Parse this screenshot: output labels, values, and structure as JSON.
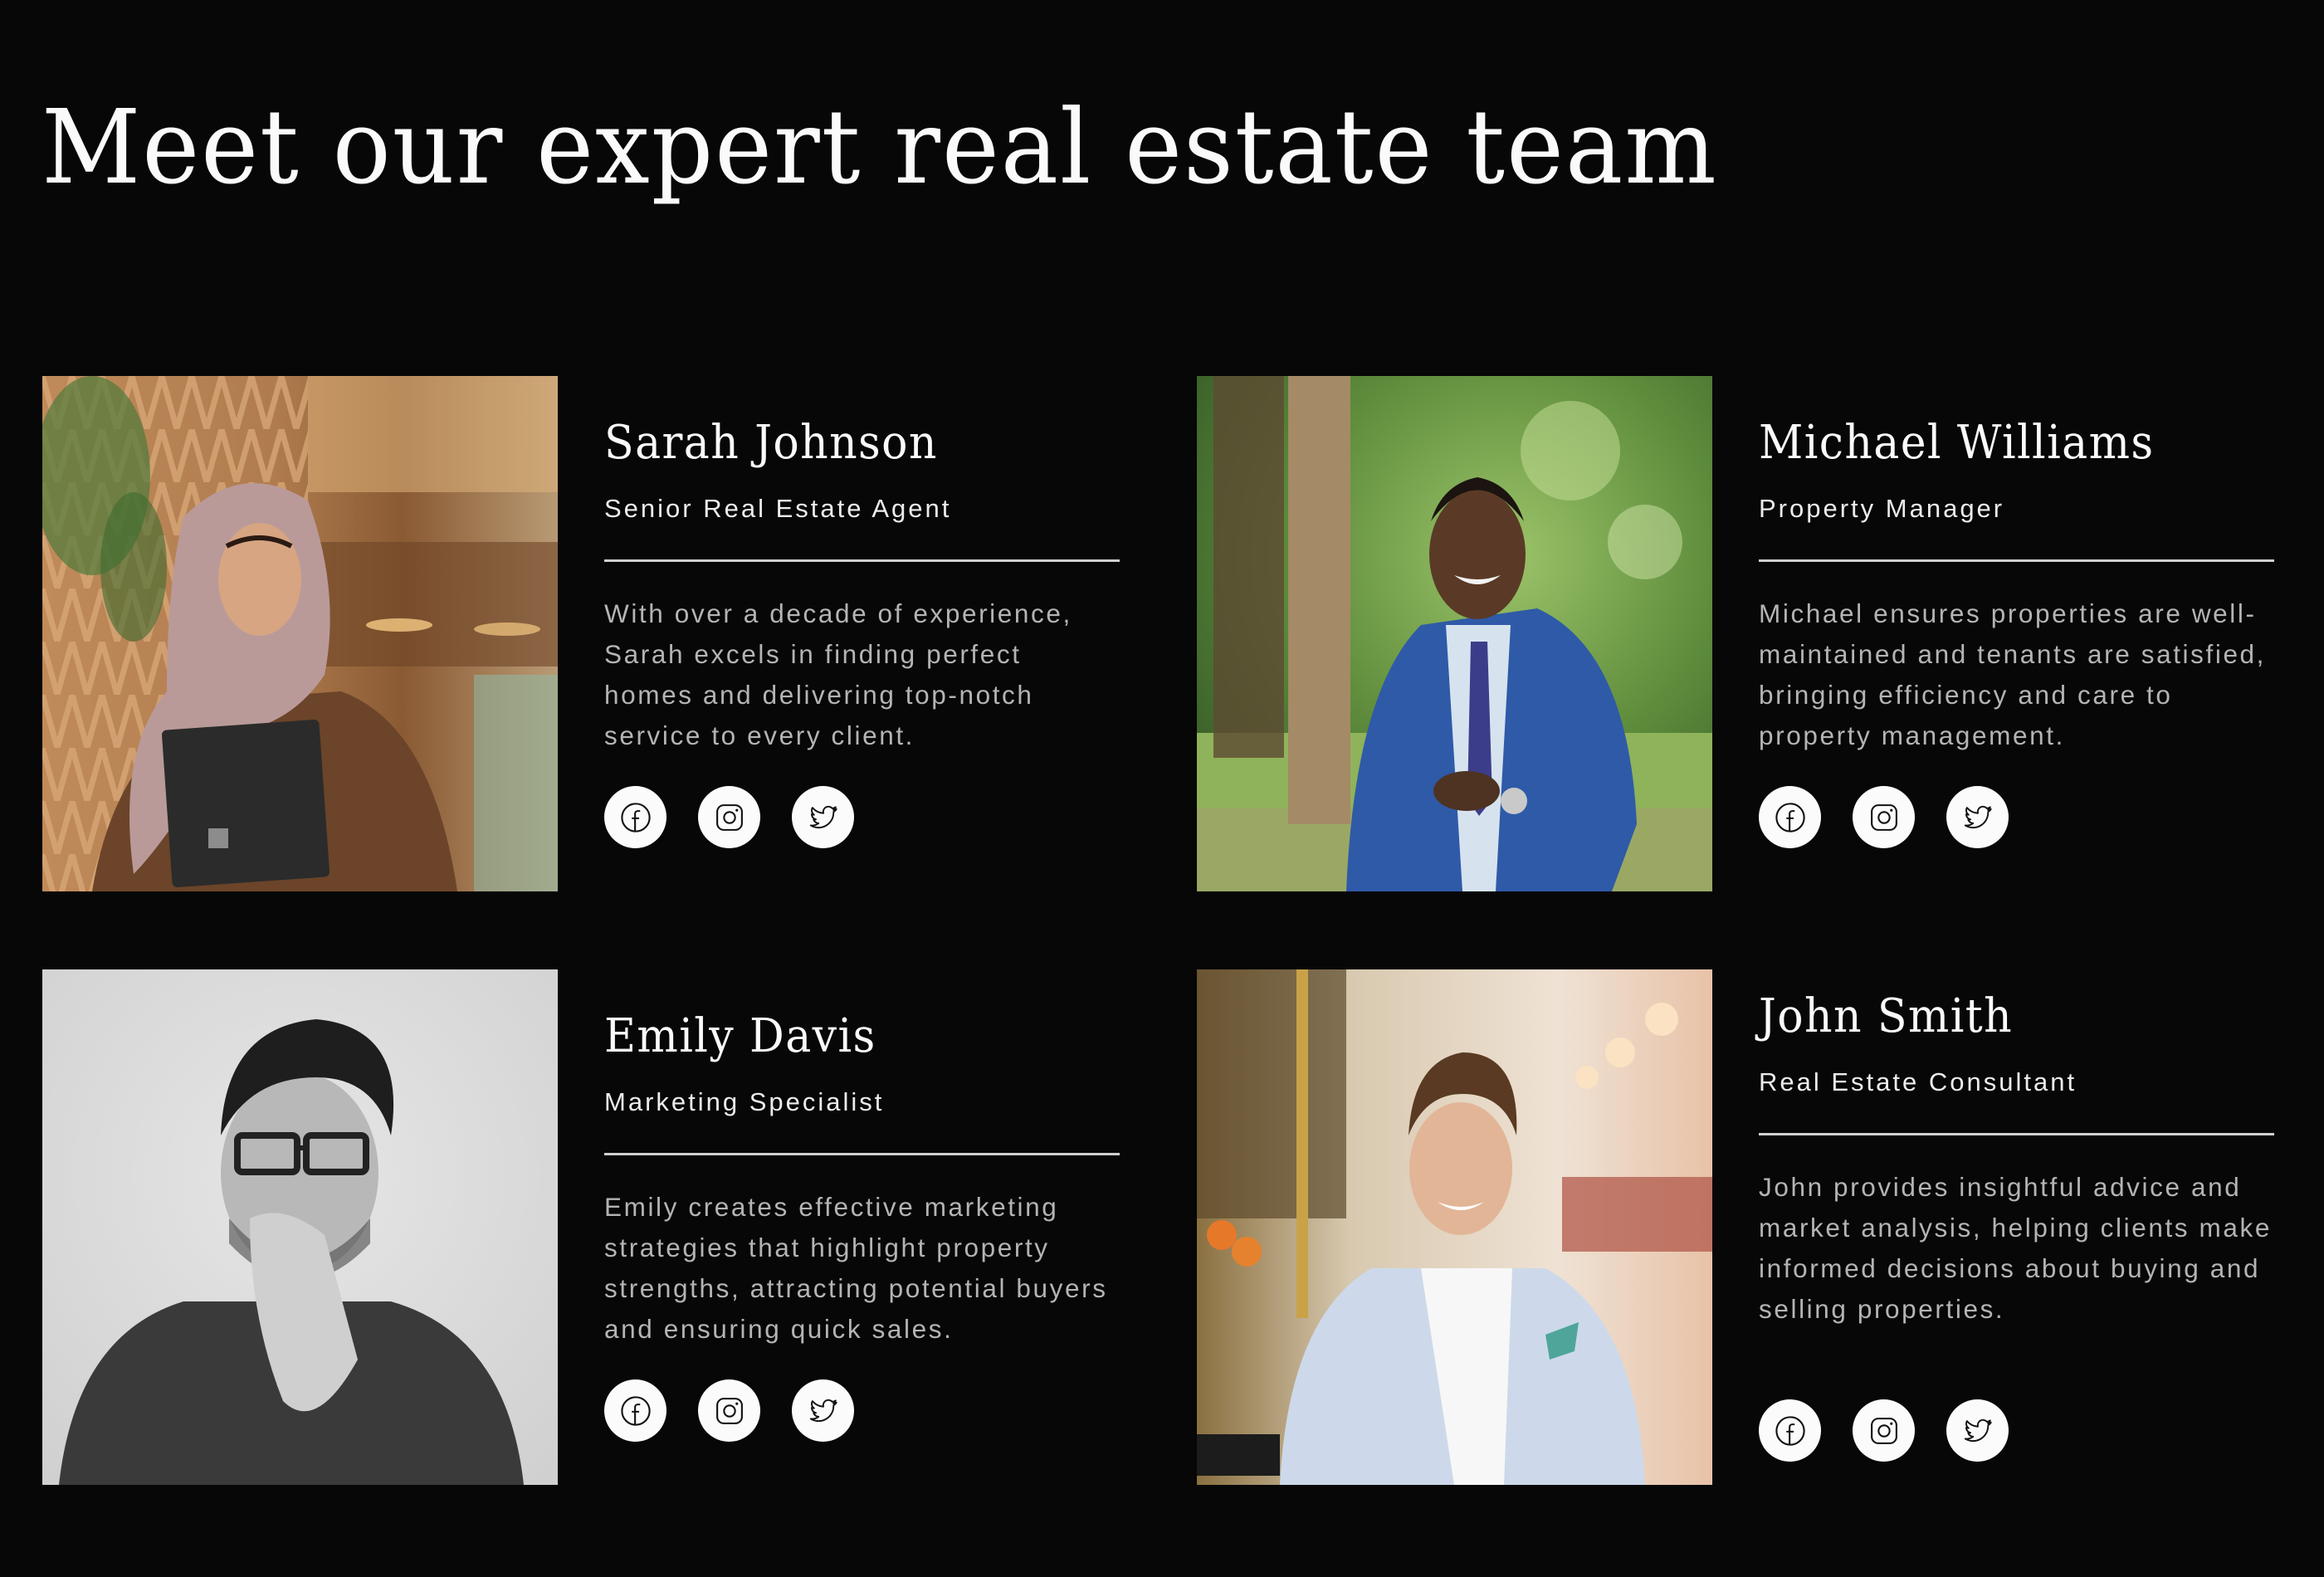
{
  "header": {
    "title": "Meet our expert real estate team"
  },
  "team": [
    {
      "name": "Sarah Johnson",
      "role": "Senior Real Estate Agent",
      "bio": "With over a decade of experience, Sarah excels in finding perfect homes and delivering top-notch service to every client.",
      "photo_alt": "Woman in a mauve hijab holding a black laptop in a warm-toned cafe",
      "socials": [
        "facebook-icon",
        "instagram-icon",
        "twitter-icon"
      ]
    },
    {
      "name": "Michael Williams",
      "role": "Property Manager",
      "bio": "Michael ensures properties are well-maintained and tenants are satisfied, bringing efficiency and care to property management.",
      "photo_alt": "Smiling man in a blue suit and purple tie standing in a sunny park",
      "socials": [
        "facebook-icon",
        "instagram-icon",
        "twitter-icon"
      ]
    },
    {
      "name": "Emily Davis",
      "role": "Marketing Specialist",
      "bio": "Emily creates effective marketing strategies that highlight property strengths, attracting potential buyers and ensuring quick sales.",
      "photo_alt": "Black and white portrait of a man with glasses resting his chin on his hand",
      "socials": [
        "facebook-icon",
        "instagram-icon",
        "twitter-icon"
      ]
    },
    {
      "name": "John Smith",
      "role": "Real Estate Consultant",
      "bio": "John provides insightful advice and market analysis, helping clients make informed decisions about buying and selling properties.",
      "photo_alt": "Smiling man in a light blue blazer seated at a restaurant bar",
      "socials": [
        "facebook-icon",
        "instagram-icon",
        "twitter-icon"
      ]
    }
  ],
  "colors": {
    "background": "#070707",
    "heading": "#fafafa",
    "role": "#ececec",
    "bio": "#b4b4b4",
    "divider": "#cfcfcf",
    "social_bg": "#fbfbfb",
    "social_icon": "#111111"
  }
}
